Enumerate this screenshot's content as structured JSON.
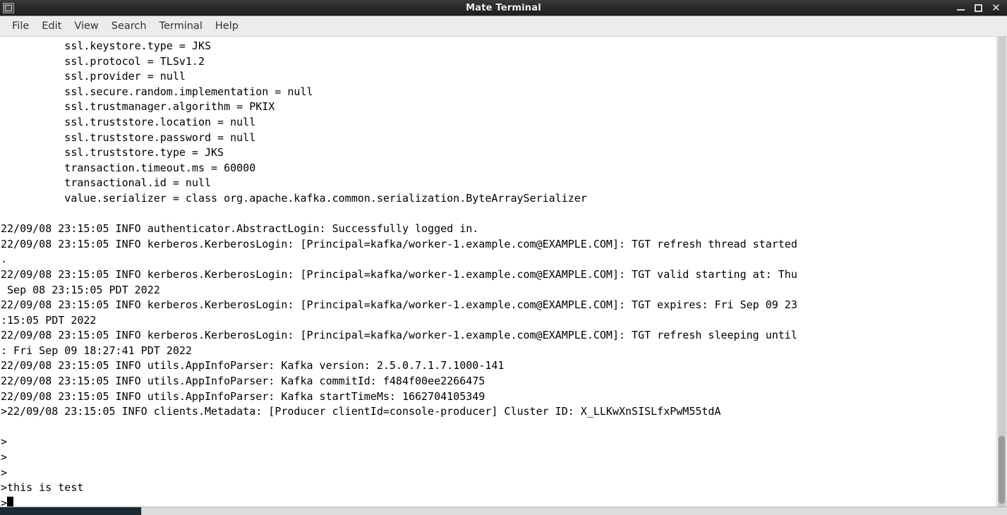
{
  "window": {
    "title": "Mate Terminal",
    "icon": "terminal-icon",
    "controls": {
      "minimize": "—",
      "maximize": "□",
      "close": "✕"
    }
  },
  "menubar": {
    "items": [
      {
        "label": "File"
      },
      {
        "label": "Edit"
      },
      {
        "label": "View"
      },
      {
        "label": "Search"
      },
      {
        "label": "Terminal"
      },
      {
        "label": "Help"
      }
    ]
  },
  "terminal": {
    "prompt_symbol": ">",
    "cursor": "block",
    "lines": [
      "          ssl.keystore.type = JKS",
      "          ssl.protocol = TLSv1.2",
      "          ssl.provider = null",
      "          ssl.secure.random.implementation = null",
      "          ssl.trustmanager.algorithm = PKIX",
      "          ssl.truststore.location = null",
      "          ssl.truststore.password = null",
      "          ssl.truststore.type = JKS",
      "          transaction.timeout.ms = 60000",
      "          transactional.id = null",
      "          value.serializer = class org.apache.kafka.common.serialization.ByteArraySerializer",
      "",
      "22/09/08 23:15:05 INFO authenticator.AbstractLogin: Successfully logged in.",
      "22/09/08 23:15:05 INFO kerberos.KerberosLogin: [Principal=kafka/worker-1.example.com@EXAMPLE.COM]: TGT refresh thread started",
      ".",
      "22/09/08 23:15:05 INFO kerberos.KerberosLogin: [Principal=kafka/worker-1.example.com@EXAMPLE.COM]: TGT valid starting at: Thu",
      " Sep 08 23:15:05 PDT 2022",
      "22/09/08 23:15:05 INFO kerberos.KerberosLogin: [Principal=kafka/worker-1.example.com@EXAMPLE.COM]: TGT expires: Fri Sep 09 23",
      ":15:05 PDT 2022",
      "22/09/08 23:15:05 INFO kerberos.KerberosLogin: [Principal=kafka/worker-1.example.com@EXAMPLE.COM]: TGT refresh sleeping until",
      ": Fri Sep 09 18:27:41 PDT 2022",
      "22/09/08 23:15:05 INFO utils.AppInfoParser: Kafka version: 2.5.0.7.1.7.1000-141",
      "22/09/08 23:15:05 INFO utils.AppInfoParser: Kafka commitId: f484f00ee2266475",
      "22/09/08 23:15:05 INFO utils.AppInfoParser: Kafka startTimeMs: 1662704105349",
      ">22/09/08 23:15:05 INFO clients.Metadata: [Producer clientId=console-producer] Cluster ID: X_LLKwXnSISLfxPwM55tdA",
      "",
      ">",
      ">",
      ">",
      ">this is test"
    ],
    "current_input_line": ">"
  },
  "scrollbar": {
    "orientation": "vertical",
    "thumb_position": "bottom"
  },
  "taskbar": {
    "active_window": "Mate Terminal"
  },
  "colors": {
    "terminal_bg": "#ffffff",
    "terminal_fg": "#000000",
    "titlebar_bg": "#2b2b2b",
    "menubar_bg": "#ececec",
    "scrollbar_thumb": "#9a9a9a"
  }
}
